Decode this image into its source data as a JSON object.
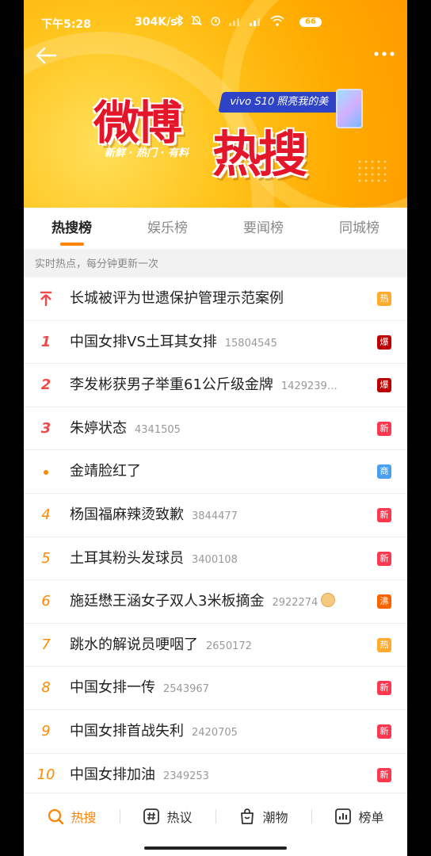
{
  "status_bar": {
    "time": "下午5:28",
    "network_speed": "304K/s",
    "battery": "66"
  },
  "banner": {
    "logo_line1": "微博",
    "logo_line2": "热搜",
    "slogan": "新鲜 · 热门 · 有料",
    "ad_text": "vivo S10 照亮我的美"
  },
  "tabs": [
    {
      "label": "热搜榜",
      "active": true
    },
    {
      "label": "娱乐榜",
      "active": false
    },
    {
      "label": "要闻榜",
      "active": false
    },
    {
      "label": "同城榜",
      "active": false
    }
  ],
  "subheader": "实时热点，每分钟更新一次",
  "items": [
    {
      "rank": "",
      "title": "长城被评为世遗保护管理示范案例",
      "count": "",
      "badge": "热",
      "badge_type": "hot"
    },
    {
      "rank": "1",
      "title": "中国女排VS土耳其女排",
      "count": "15804545",
      "badge": "爆",
      "badge_type": "boom"
    },
    {
      "rank": "2",
      "title": "李发彬获男子举重61公斤级金牌",
      "count": "1429239…",
      "badge": "爆",
      "badge_type": "boom"
    },
    {
      "rank": "3",
      "title": "朱婷状态",
      "count": "4341505",
      "badge": "新",
      "badge_type": "new"
    },
    {
      "rank": "",
      "title": "金靖脸红了",
      "count": "",
      "badge": "商",
      "badge_type": "biz"
    },
    {
      "rank": "4",
      "title": "杨国福麻辣烫致歉",
      "count": "3844477",
      "badge": "新",
      "badge_type": "new"
    },
    {
      "rank": "5",
      "title": "土耳其粉头发球员",
      "count": "3400108",
      "badge": "新",
      "badge_type": "new"
    },
    {
      "rank": "6",
      "title": "施廷懋王涵女子双人3米板摘金",
      "count": "2922274",
      "badge": "沸",
      "badge_type": "boil"
    },
    {
      "rank": "7",
      "title": "跳水的解说员哽咽了",
      "count": "2650172",
      "badge": "热",
      "badge_type": "hot"
    },
    {
      "rank": "8",
      "title": "中国女排一传",
      "count": "2543967",
      "badge": "新",
      "badge_type": "new"
    },
    {
      "rank": "9",
      "title": "中国女排首战失利",
      "count": "2420705",
      "badge": "新",
      "badge_type": "new"
    },
    {
      "rank": "10",
      "title": "中国女排加油",
      "count": "2349253",
      "badge": "新",
      "badge_type": "new"
    }
  ],
  "bottom_nav": [
    {
      "label": "热搜",
      "icon": "search-icon",
      "active": true
    },
    {
      "label": "热议",
      "icon": "hashtag-icon",
      "active": false
    },
    {
      "label": "潮物",
      "icon": "shopping-bag-icon",
      "active": false
    },
    {
      "label": "榜单",
      "icon": "chart-icon",
      "active": false
    }
  ],
  "colors": {
    "accent": "#ff8200",
    "banner": "#ffb400",
    "rank_top": "#f04a4a",
    "rank_rest": "#ff8a00"
  }
}
